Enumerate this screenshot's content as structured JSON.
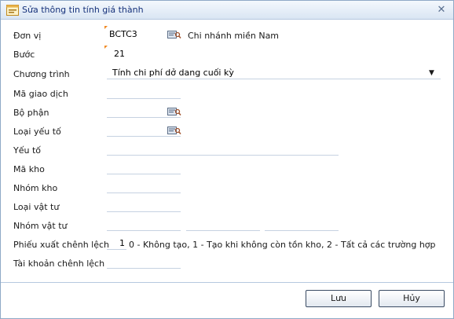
{
  "window": {
    "title": "Sửa thông tin tính giá thành",
    "close_glyph": "✕"
  },
  "form": {
    "don_vi": {
      "label": "Đơn vị",
      "value": "BCTC3",
      "description": "Chi nhánh miền Nam"
    },
    "buoc": {
      "label": "Bước",
      "value": "21"
    },
    "chuong_trinh": {
      "label": "Chương trình",
      "value": "Tính chi phí dở dang cuối kỳ"
    },
    "ma_giao_dich": {
      "label": "Mã giao dịch",
      "value": ""
    },
    "bo_phan": {
      "label": "Bộ phận",
      "value": ""
    },
    "loai_yeu_to": {
      "label": "Loại yếu tố",
      "value": ""
    },
    "yeu_to": {
      "label": "Yếu tố",
      "value": ""
    },
    "ma_kho": {
      "label": "Mã kho",
      "value": ""
    },
    "nhom_kho": {
      "label": "Nhóm kho",
      "value": ""
    },
    "loai_vat_tu": {
      "label": "Loại vật tư",
      "value": ""
    },
    "nhom_vat_tu": {
      "label": "Nhóm vật tư",
      "values": [
        "",
        "",
        ""
      ]
    },
    "phieu_xuat_chenh_lech": {
      "label": "Phiếu xuất chênh lệch",
      "value": "1",
      "hint": "0 - Không tạo, 1 - Tạo khi không còn tồn kho, 2 - Tất cả các trường hợp"
    },
    "tai_khoan_chenh_lech": {
      "label": "Tài khoản chênh lệch",
      "value": ""
    }
  },
  "buttons": {
    "save": "Lưu",
    "cancel": "Hủy"
  },
  "icons": {
    "window": "window-form-icon",
    "lookup": "lookup-search-icon",
    "dropdown": "dropdown-arrow-icon"
  },
  "colors": {
    "title_text": "#15317a",
    "required_marker": "#f08a24",
    "field_underline": "#c6d2e1"
  }
}
